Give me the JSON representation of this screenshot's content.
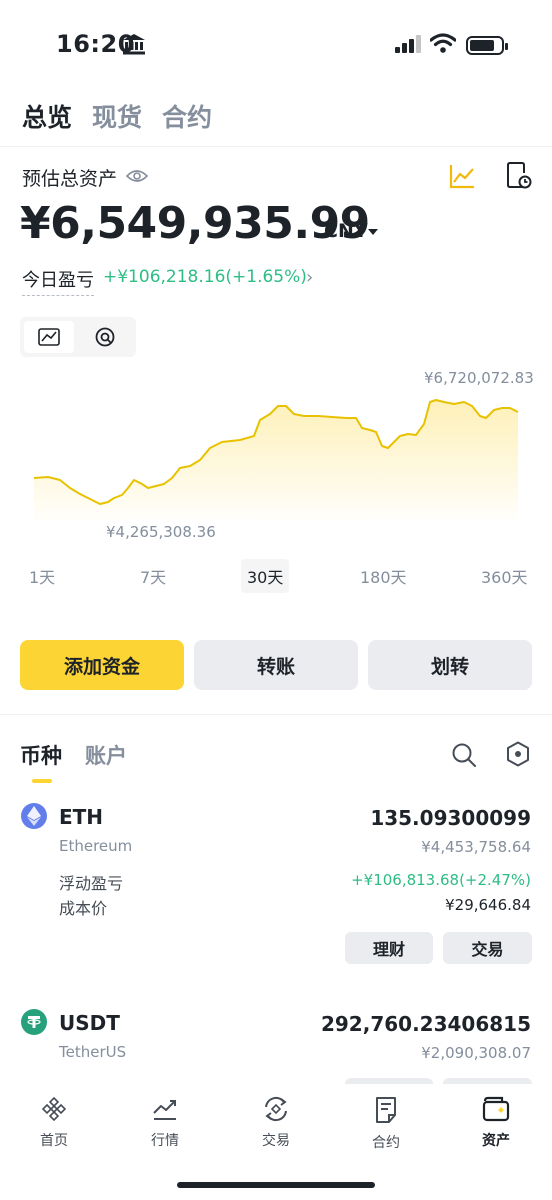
{
  "status_bar": {
    "time": "16:20"
  },
  "top_tabs": [
    "总览",
    "现货",
    "合约"
  ],
  "summary": {
    "label": "预估总资产",
    "total": "¥6,549,935.99",
    "currency": "CNY",
    "pnl_label": "今日盈亏",
    "pnl_value": "+¥106,218.16(+1.65%)"
  },
  "chart": {
    "max_label": "¥6,720,072.83",
    "min_label": "¥4,265,308.36",
    "accent": "#f0b90b"
  },
  "periods": [
    "1天",
    "7天",
    "30天",
    "180天",
    "360天"
  ],
  "actions": [
    "添加资金",
    "转账",
    "划转"
  ],
  "list_tabs": [
    "币种",
    "账户"
  ],
  "assets": [
    {
      "symbol": "ETH",
      "name": "Ethereum",
      "amount": "135.09300099",
      "value": "¥4,453,758.64",
      "float_label": "浮动盈亏",
      "float_value": "+¥106,813.68(+2.47%)",
      "cost_label": "成本价",
      "cost_value": "¥29,646.84",
      "btn1": "理财",
      "btn2": "交易"
    },
    {
      "symbol": "USDT",
      "name": "TetherUS",
      "amount": "292,760.23406815",
      "value": "¥2,090,308.07"
    }
  ],
  "bottom_nav": [
    "首页",
    "行情",
    "交易",
    "合约",
    "资产"
  ]
}
